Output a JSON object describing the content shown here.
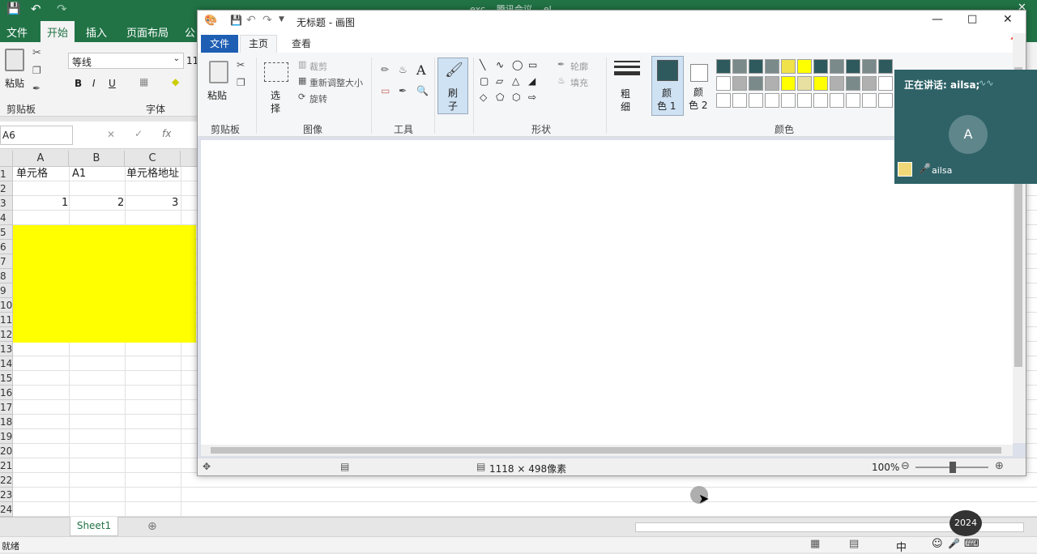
{
  "excel": {
    "title_center": "exc... 腾讯会议 ...el",
    "tabs": [
      "文件",
      "开始",
      "插入",
      "页面布局",
      "公"
    ],
    "font_name": "等线",
    "font_size": "11",
    "group_clipboard": "剪贴板",
    "group_font": "字体",
    "paste_label": "粘贴",
    "name_box": "A6",
    "columns": [
      "A",
      "B",
      "C"
    ],
    "rows": [
      "1",
      "2",
      "3",
      "4",
      "5",
      "6",
      "7",
      "8",
      "9",
      "10",
      "11",
      "12",
      "13",
      "14",
      "15",
      "16",
      "17",
      "18",
      "19",
      "20",
      "21",
      "22",
      "23",
      "24"
    ],
    "cells": {
      "A1": "单元格",
      "B1": "A1",
      "C1": "单元格地址",
      "A3": "1",
      "B3": "2",
      "C3": "3"
    },
    "fill_color": "#ffff00",
    "sheet_tab": "Sheet1",
    "status_ready": "就绪",
    "accent": "#217346"
  },
  "paint": {
    "title": "无标题 - 画图",
    "tabs": {
      "file": "文件",
      "home": "主页",
      "view": "查看"
    },
    "clipboard": {
      "paste": "粘贴",
      "group": "剪贴板"
    },
    "image": {
      "select_top": "选",
      "select_bottom": "择",
      "crop": "裁剪",
      "resize": "重新调整大小",
      "rotate": "旋转",
      "group": "图像"
    },
    "tools": {
      "group": "工具",
      "text_glyph": "A"
    },
    "brush": {
      "top": "刷",
      "bottom": "子"
    },
    "shapes": {
      "outline": "轮廓",
      "fill": "填充",
      "group": "形状"
    },
    "size": {
      "top": "粗",
      "bottom": "细"
    },
    "color1": {
      "top": "颜",
      "bottom": "色 1"
    },
    "color2": {
      "top": "颜",
      "bottom": "色 2"
    },
    "colors_group": "颜色",
    "palette_row1": [
      "#2e5a5e",
      "#7a8a8b",
      "#2e5a5e",
      "#7a8a8b",
      "#f0e24a",
      "#ffff00",
      "#2e5a5e",
      "#7a8a8b",
      "#2e5a5e",
      "#7a8a8b",
      "#2e5a5e"
    ],
    "palette_row2": [
      "#ffffff",
      "#b0b0b0",
      "#7a8a8b",
      "#b0b0b0",
      "#ffff00",
      "#e8e0a0",
      "#ffff00",
      "#b0b0b0",
      "#7a8a8b",
      "#b0b0b0",
      "#ffffff"
    ],
    "selected_color": "#2e5a5e",
    "dimensions": "1118 × 498像素",
    "zoom": "100%"
  },
  "meeting": {
    "speaking": "正在讲话: ailsa;",
    "avatar_letter": "A",
    "user": "ailsa"
  },
  "taskbar": {
    "ime": "中",
    "year_badge": "2024"
  }
}
